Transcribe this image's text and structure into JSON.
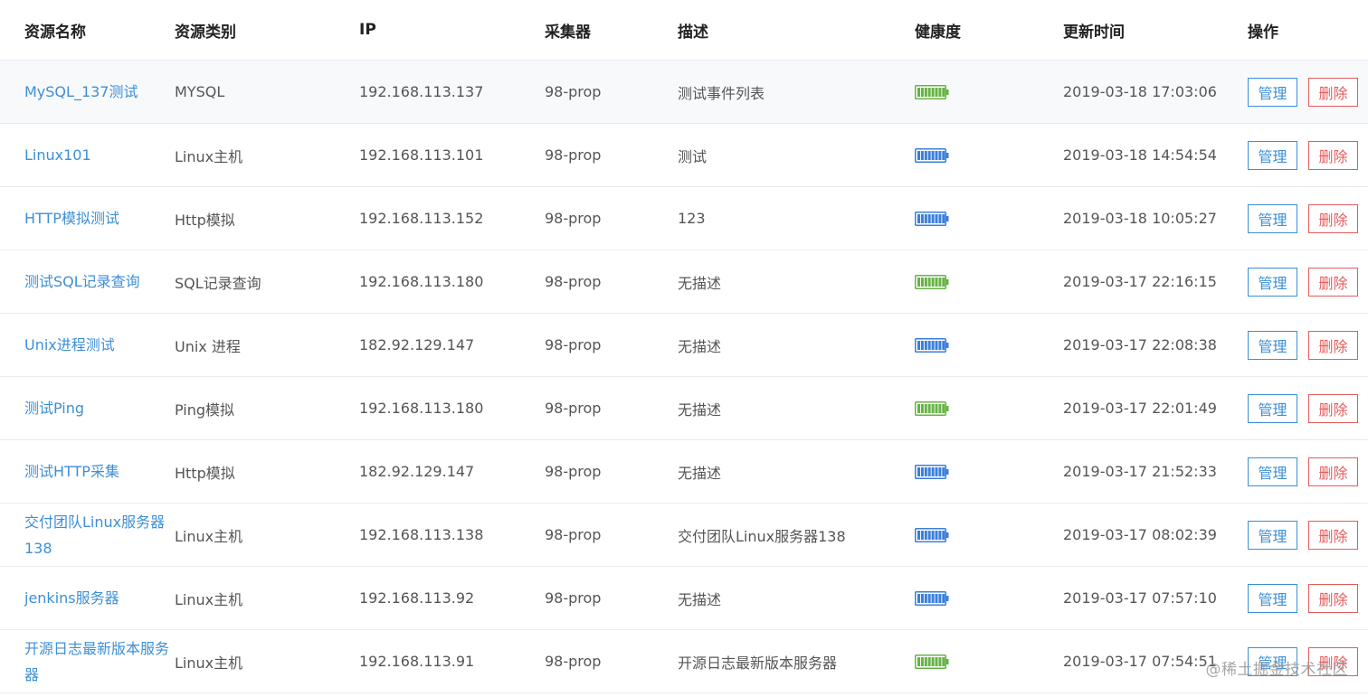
{
  "colors": {
    "link": "#3d8fd6",
    "danger": "#e55b5b",
    "health_good": "#67b346",
    "health_normal": "#3b7fd9"
  },
  "table": {
    "headers": [
      "资源名称",
      "资源类别",
      "IP",
      "采集器",
      "描述",
      "健康度",
      "更新时间",
      "操作"
    ],
    "rows": [
      {
        "name": "MySQL_137测试",
        "category": "MYSQL",
        "ip": "192.168.113.137",
        "collector": "98-prop",
        "description": "测试事件列表",
        "health": "green-battery-icon",
        "updated": "2019-03-18 17:03:06",
        "manage": "管理",
        "delete": "删除"
      },
      {
        "name": "Linux101",
        "category": "Linux主机",
        "ip": "192.168.113.101",
        "collector": "98-prop",
        "description": "测试",
        "health": "blue-battery-icon",
        "updated": "2019-03-18 14:54:54",
        "manage": "管理",
        "delete": "删除"
      },
      {
        "name": "HTTP模拟测试",
        "category": "Http模拟",
        "ip": "192.168.113.152",
        "collector": "98-prop",
        "description": "123",
        "health": "blue-battery-icon",
        "updated": "2019-03-18 10:05:27",
        "manage": "管理",
        "delete": "删除"
      },
      {
        "name": "测试SQL记录查询",
        "category": "SQL记录查询",
        "ip": "192.168.113.180",
        "collector": "98-prop",
        "description": "无描述",
        "health": "green-battery-icon",
        "updated": "2019-03-17 22:16:15",
        "manage": "管理",
        "delete": "删除"
      },
      {
        "name": "Unix进程测试",
        "category": "Unix 进程",
        "ip": "182.92.129.147",
        "collector": "98-prop",
        "description": "无描述",
        "health": "blue-battery-icon",
        "updated": "2019-03-17 22:08:38",
        "manage": "管理",
        "delete": "删除"
      },
      {
        "name": "测试Ping",
        "category": "Ping模拟",
        "ip": "192.168.113.180",
        "collector": "98-prop",
        "description": "无描述",
        "health": "green-battery-icon",
        "updated": "2019-03-17 22:01:49",
        "manage": "管理",
        "delete": "删除"
      },
      {
        "name": "测试HTTP采集",
        "category": "Http模拟",
        "ip": "182.92.129.147",
        "collector": "98-prop",
        "description": "无描述",
        "health": "blue-battery-icon",
        "updated": "2019-03-17 21:52:33",
        "manage": "管理",
        "delete": "删除"
      },
      {
        "name": "交付团队Linux服务器138",
        "category": "Linux主机",
        "ip": "192.168.113.138",
        "collector": "98-prop",
        "description": "交付团队Linux服务器138",
        "health": "blue-battery-icon",
        "updated": "2019-03-17 08:02:39",
        "manage": "管理",
        "delete": "删除"
      },
      {
        "name": "jenkins服务器",
        "category": "Linux主机",
        "ip": "192.168.113.92",
        "collector": "98-prop",
        "description": "无描述",
        "health": "blue-battery-icon",
        "updated": "2019-03-17 07:57:10",
        "manage": "管理",
        "delete": "删除"
      },
      {
        "name": "开源日志最新版本服务器",
        "category": "Linux主机",
        "ip": "192.168.113.91",
        "collector": "98-prop",
        "description": "开源日志最新版本服务器",
        "health": "green-battery-icon",
        "updated": "2019-03-17 07:54:51",
        "manage": "管理",
        "delete": "删除"
      }
    ]
  },
  "watermark": "@稀土掘金技术社区"
}
